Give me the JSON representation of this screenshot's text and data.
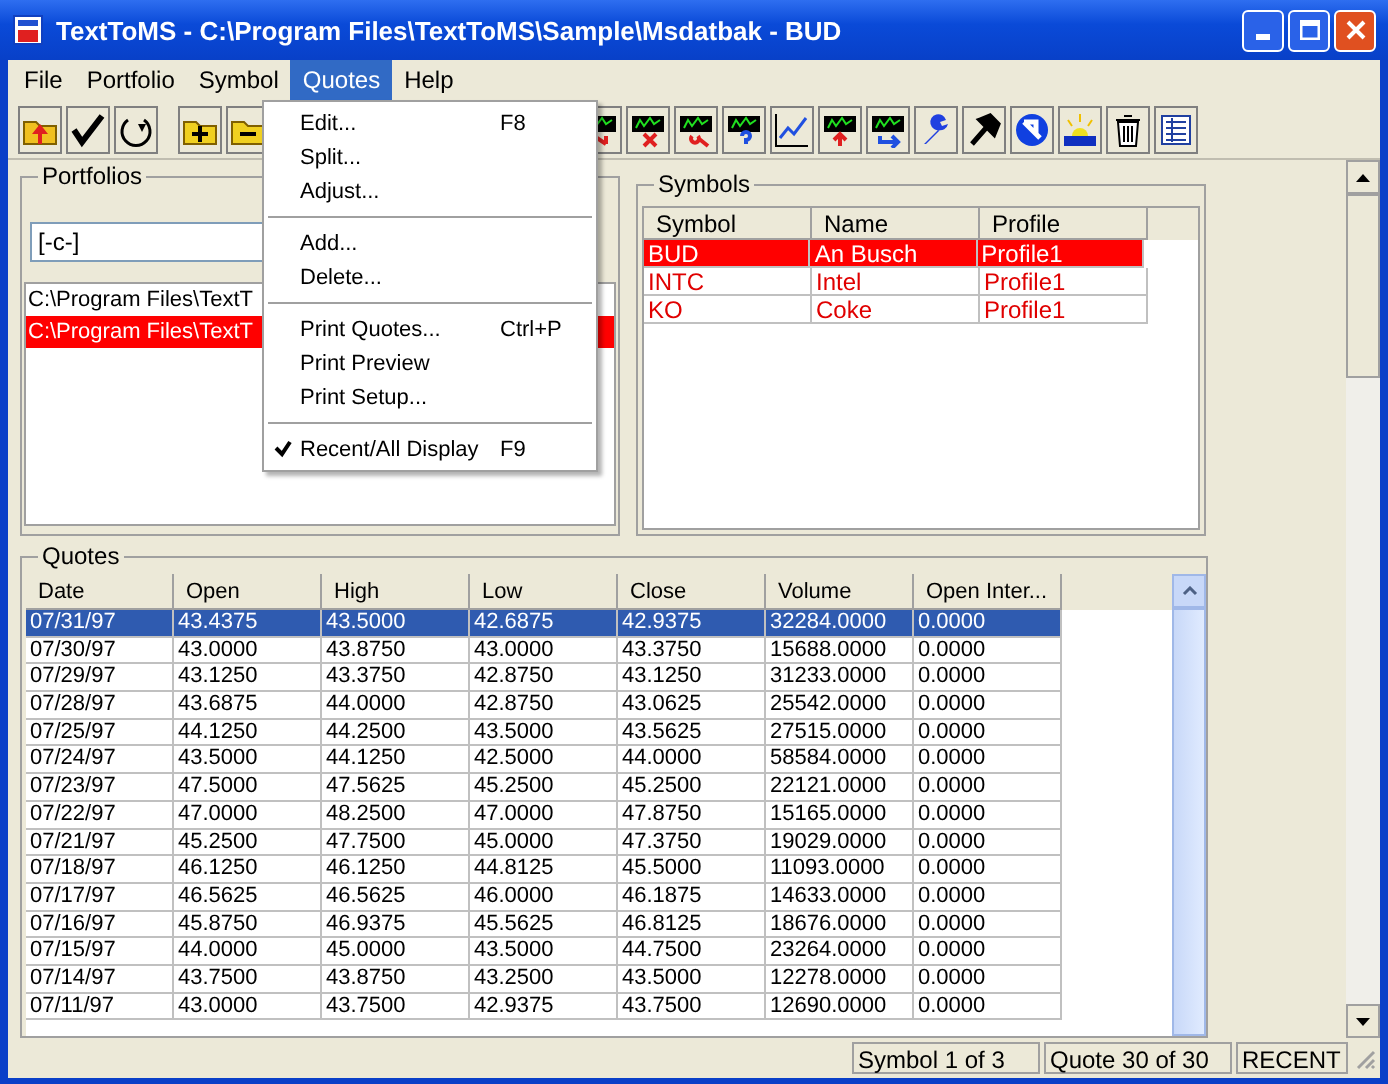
{
  "window": {
    "title": "TextToMS - C:\\Program Files\\TextToMS\\Sample\\Msdatbak - BUD"
  },
  "menu_bar": [
    {
      "label": "File",
      "selected": false
    },
    {
      "label": "Portfolio",
      "selected": false
    },
    {
      "label": "Symbol",
      "selected": false
    },
    {
      "label": "Quotes",
      "selected": true
    },
    {
      "label": "Help",
      "selected": false
    }
  ],
  "quotes_menu": [
    {
      "kind": "item",
      "label": "Edit...",
      "shortcut": "F8"
    },
    {
      "kind": "item",
      "label": "Split..."
    },
    {
      "kind": "item",
      "label": "Adjust..."
    },
    {
      "kind": "separator"
    },
    {
      "kind": "item",
      "label": "Add..."
    },
    {
      "kind": "item",
      "label": "Delete..."
    },
    {
      "kind": "separator"
    },
    {
      "kind": "item",
      "label": "Print Quotes...",
      "shortcut": "Ctrl+P"
    },
    {
      "kind": "item",
      "label": "Print Preview"
    },
    {
      "kind": "item",
      "label": "Print Setup..."
    },
    {
      "kind": "separator"
    },
    {
      "kind": "item",
      "label": "Recent/All Display",
      "shortcut": "F9",
      "checked": true
    }
  ],
  "portfolios": {
    "title": "Portfolios",
    "combo_value": "[-c-]",
    "items": [
      {
        "label": "C:\\Program Files\\TextT",
        "selected": false
      },
      {
        "label": "C:\\Program Files\\TextT",
        "selected": true
      }
    ]
  },
  "symbols": {
    "title": "Symbols",
    "columns": [
      "Symbol",
      "Name",
      "Profile"
    ],
    "rows": [
      {
        "cells": [
          "BUD",
          "An Busch",
          "Profile1"
        ],
        "selected": true
      },
      {
        "cells": [
          "INTC",
          "Intel",
          "Profile1"
        ],
        "selected": false
      },
      {
        "cells": [
          "KO",
          "Coke",
          "Profile1"
        ],
        "selected": false
      }
    ]
  },
  "quotes": {
    "title": "Quotes",
    "columns": [
      "Date",
      "Open",
      "High",
      "Low",
      "Close",
      "Volume",
      "Open Inter..."
    ],
    "rows": [
      {
        "cells": [
          "07/31/97",
          "43.4375",
          "43.5000",
          "42.6875",
          "42.9375",
          "32284.0000",
          "0.0000"
        ],
        "selected": true
      },
      {
        "cells": [
          "07/30/97",
          "43.0000",
          "43.8750",
          "43.0000",
          "43.3750",
          "15688.0000",
          "0.0000"
        ],
        "selected": false
      },
      {
        "cells": [
          "07/29/97",
          "43.1250",
          "43.3750",
          "42.8750",
          "43.1250",
          "31233.0000",
          "0.0000"
        ],
        "selected": false
      },
      {
        "cells": [
          "07/28/97",
          "43.6875",
          "44.0000",
          "42.8750",
          "43.0625",
          "25542.0000",
          "0.0000"
        ],
        "selected": false
      },
      {
        "cells": [
          "07/25/97",
          "44.1250",
          "44.2500",
          "43.5000",
          "43.5625",
          "27515.0000",
          "0.0000"
        ],
        "selected": false
      },
      {
        "cells": [
          "07/24/97",
          "43.5000",
          "44.1250",
          "42.5000",
          "44.0000",
          "58584.0000",
          "0.0000"
        ],
        "selected": false
      },
      {
        "cells": [
          "07/23/97",
          "47.5000",
          "47.5625",
          "45.2500",
          "45.2500",
          "22121.0000",
          "0.0000"
        ],
        "selected": false
      },
      {
        "cells": [
          "07/22/97",
          "47.0000",
          "48.2500",
          "47.0000",
          "47.8750",
          "15165.0000",
          "0.0000"
        ],
        "selected": false
      },
      {
        "cells": [
          "07/21/97",
          "45.2500",
          "47.7500",
          "45.0000",
          "47.3750",
          "19029.0000",
          "0.0000"
        ],
        "selected": false
      },
      {
        "cells": [
          "07/18/97",
          "46.1250",
          "46.1250",
          "44.8125",
          "45.5000",
          "11093.0000",
          "0.0000"
        ],
        "selected": false
      },
      {
        "cells": [
          "07/17/97",
          "46.5625",
          "46.5625",
          "46.0000",
          "46.1875",
          "14633.0000",
          "0.0000"
        ],
        "selected": false
      },
      {
        "cells": [
          "07/16/97",
          "45.8750",
          "46.9375",
          "45.5625",
          "46.8125",
          "18676.0000",
          "0.0000"
        ],
        "selected": false
      },
      {
        "cells": [
          "07/15/97",
          "44.0000",
          "45.0000",
          "43.5000",
          "44.7500",
          "23264.0000",
          "0.0000"
        ],
        "selected": false
      },
      {
        "cells": [
          "07/14/97",
          "43.7500",
          "43.8750",
          "43.2500",
          "43.5000",
          "12278.0000",
          "0.0000"
        ],
        "selected": false
      },
      {
        "cells": [
          "07/11/97",
          "43.0000",
          "43.7500",
          "42.9375",
          "43.7500",
          "12690.0000",
          "0.0000"
        ],
        "selected": false
      }
    ]
  },
  "status_bar": [
    "Symbol 1 of 3",
    "Quote 30 of 30",
    "RECENT"
  ]
}
